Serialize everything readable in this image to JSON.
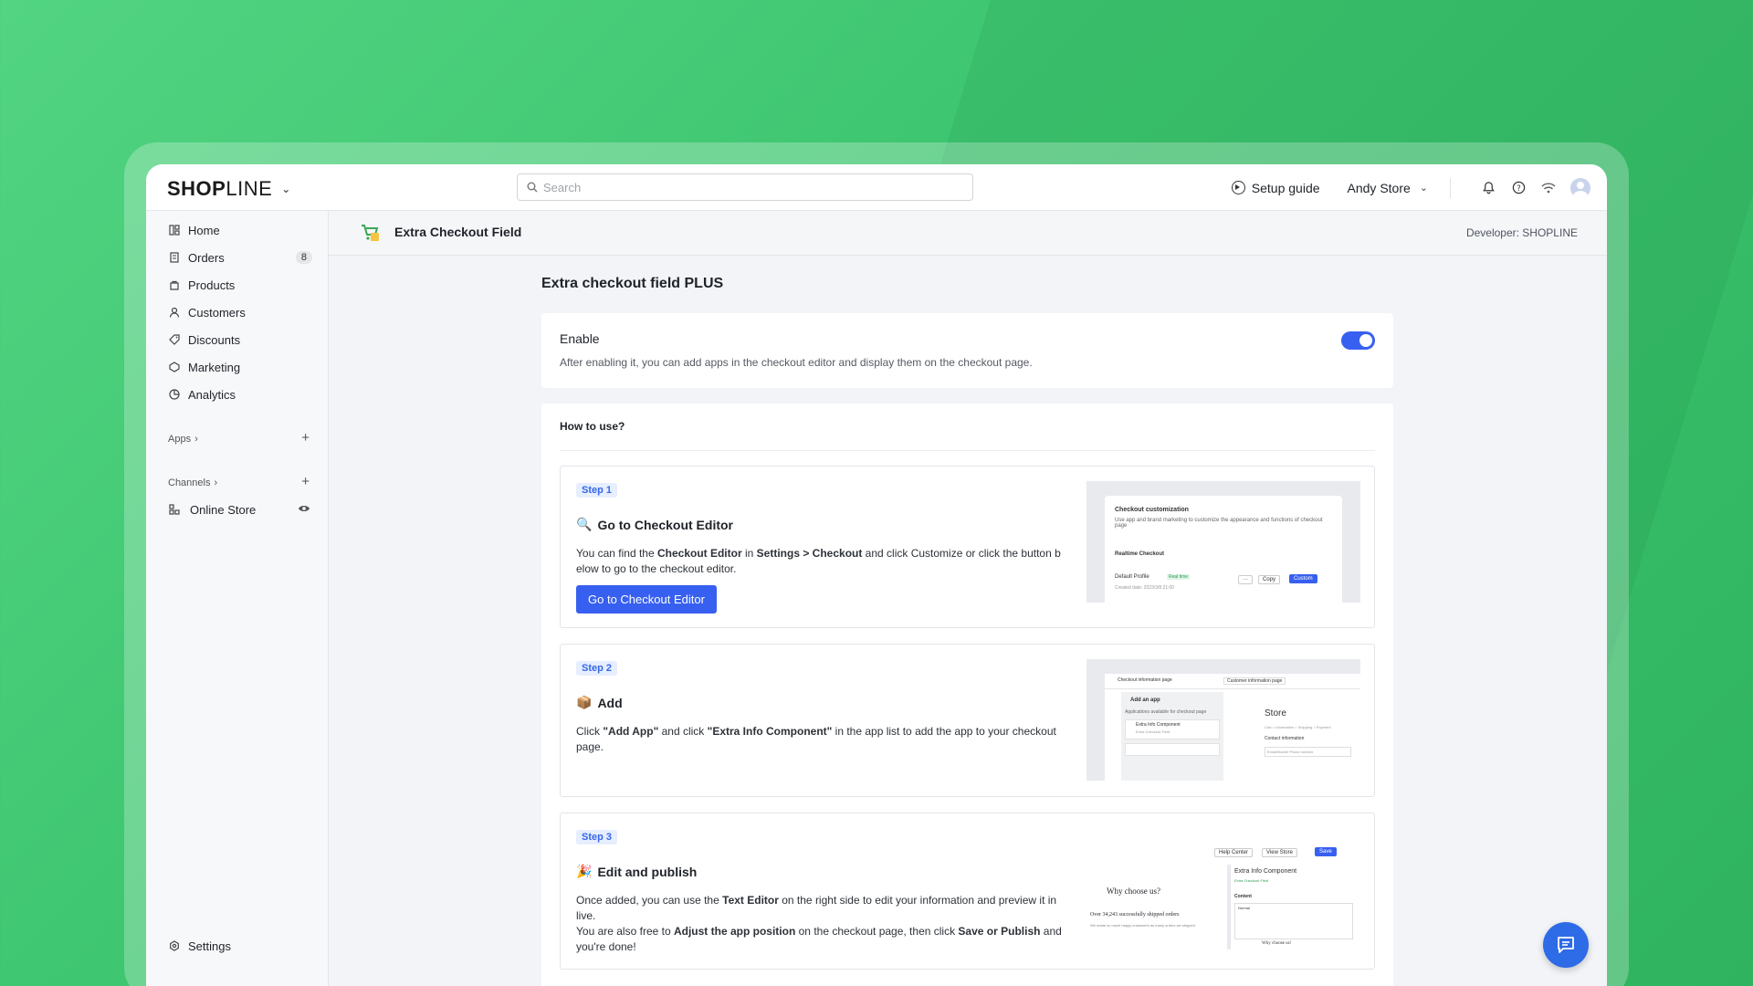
{
  "brand": {
    "logo_bold": "SHOP",
    "logo_light": "LINE"
  },
  "search": {
    "placeholder": "Search"
  },
  "topbar": {
    "setup_guide": "Setup guide",
    "store_name": "Andy Store"
  },
  "sidebar": {
    "items": [
      {
        "label": "Home",
        "icon": "home-icon"
      },
      {
        "label": "Orders",
        "icon": "orders-icon",
        "badge": "8"
      },
      {
        "label": "Products",
        "icon": "products-icon"
      },
      {
        "label": "Customers",
        "icon": "customers-icon"
      },
      {
        "label": "Discounts",
        "icon": "discounts-icon"
      },
      {
        "label": "Marketing",
        "icon": "marketing-icon"
      },
      {
        "label": "Analytics",
        "icon": "analytics-icon"
      }
    ],
    "apps_label": "Apps",
    "channels_label": "Channels",
    "online_store": "Online Store",
    "settings": "Settings"
  },
  "app_header": {
    "title": "Extra Checkout Field",
    "developer": "Developer: SHOPLINE"
  },
  "main": {
    "page_title": "Extra checkout field PLUS",
    "enable": {
      "label": "Enable",
      "description": "After enabling it, you can add apps in the checkout editor and display them on the checkout page.",
      "enabled": true
    },
    "how_to_use": "How to use?",
    "steps": [
      {
        "tag": "Step 1",
        "emoji": "🔍",
        "title": "Go to Checkout Editor",
        "desc_parts": [
          "You can find the ",
          "Checkout Editor",
          " in ",
          "Settings > Checkout",
          " and click Customize or click the button b elow to go to the checkout editor."
        ],
        "button": "Go to Checkout Editor",
        "thumb": {
          "heading": "Checkout customization",
          "sub": "Use app and brand marketing to customize the appearance and functions of checkout page",
          "section": "Realtime Checkout",
          "profile": "Default Profile",
          "profile_tag": "Real time",
          "created": "Created date: 2023/3/8 21:00",
          "more": "···",
          "copy": "Copy",
          "custom": "Custom"
        }
      },
      {
        "tag": "Step 2",
        "emoji": "📦",
        "title": "Add",
        "desc_parts": [
          "Click ",
          "\"Add App\"",
          " and click ",
          "\"Extra Info Component\"",
          " in the app list to add the app to your checkout page."
        ],
        "thumb": {
          "tab1": "Checkout information page",
          "tab2": "Customer information page",
          "add_app": "Add an app",
          "avail": "Applications available for checkout page",
          "component": "Extra Info Component",
          "component_sub": "Extra Checkout Field",
          "store": "Store",
          "crumbs": "Cart  >  Information  >  Shipping  >  Payment",
          "contact": "Contact information",
          "email_ph": "Email/Mobile Phone number"
        }
      },
      {
        "tag": "Step 3",
        "emoji": "🎉",
        "title": "Edit and publish",
        "desc_parts_1": [
          "Once added, you can use the ",
          "Text Editor",
          " on the right side to edit your information and preview it in live."
        ],
        "desc_parts_2": [
          "You are also free to ",
          "Adjust the app position",
          " on the checkout page, then click ",
          "Save or Publish",
          " and you're done!"
        ],
        "thumb": {
          "help": "Help Center",
          "view": "View Store",
          "save": "Save",
          "why": "Why choose us?",
          "shipped": "Over 34,243 successfully shipped orders",
          "shipped_sub": "We made so much happy customers as many orders we shipped",
          "comp": "Extra Info Component",
          "comp_sub": "Extra Checkout Field",
          "content": "Content",
          "normal": "Normal",
          "why2": "Why choose us!"
        }
      }
    ]
  },
  "colors": {
    "accent": "#3760f0",
    "background": "#4bcd7d"
  }
}
